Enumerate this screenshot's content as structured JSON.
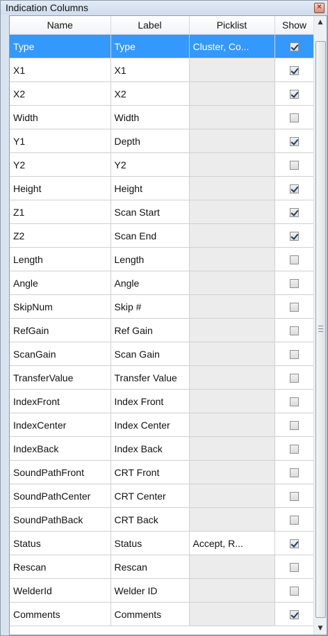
{
  "panel": {
    "title": "Indication Columns",
    "close_glyph": "✕"
  },
  "columns": {
    "name": "Name",
    "label": "Label",
    "picklist": "Picklist",
    "show": "Show"
  },
  "rows": [
    {
      "name": "Type",
      "label": "Type",
      "picklist": "Cluster, Co...",
      "show": true
    },
    {
      "name": "X1",
      "label": "X1",
      "picklist": "",
      "show": true
    },
    {
      "name": "X2",
      "label": "X2",
      "picklist": "",
      "show": true
    },
    {
      "name": "Width",
      "label": "Width",
      "picklist": "",
      "show": false
    },
    {
      "name": "Y1",
      "label": "Depth",
      "picklist": "",
      "show": true
    },
    {
      "name": "Y2",
      "label": "Y2",
      "picklist": "",
      "show": false
    },
    {
      "name": "Height",
      "label": "Height",
      "picklist": "",
      "show": true
    },
    {
      "name": "Z1",
      "label": "Scan Start",
      "picklist": "",
      "show": true
    },
    {
      "name": "Z2",
      "label": "Scan End",
      "picklist": "",
      "show": true
    },
    {
      "name": "Length",
      "label": "Length",
      "picklist": "",
      "show": false
    },
    {
      "name": "Angle",
      "label": "Angle",
      "picklist": "",
      "show": false
    },
    {
      "name": "SkipNum",
      "label": "Skip #",
      "picklist": "",
      "show": false
    },
    {
      "name": "RefGain",
      "label": "Ref Gain",
      "picklist": "",
      "show": false
    },
    {
      "name": "ScanGain",
      "label": "Scan Gain",
      "picklist": "",
      "show": false
    },
    {
      "name": "TransferValue",
      "label": "Transfer Value",
      "picklist": "",
      "show": false
    },
    {
      "name": "IndexFront",
      "label": "Index Front",
      "picklist": "",
      "show": false
    },
    {
      "name": "IndexCenter",
      "label": "Index Center",
      "picklist": "",
      "show": false
    },
    {
      "name": "IndexBack",
      "label": "Index Back",
      "picklist": "",
      "show": false
    },
    {
      "name": "SoundPathFront",
      "label": "CRT Front",
      "picklist": "",
      "show": false
    },
    {
      "name": "SoundPathCenter",
      "label": "CRT Center",
      "picklist": "",
      "show": false
    },
    {
      "name": "SoundPathBack",
      "label": "CRT Back",
      "picklist": "",
      "show": false
    },
    {
      "name": "Status",
      "label": "Status",
      "picklist": "Accept, R...",
      "show": true
    },
    {
      "name": "Rescan",
      "label": "Rescan",
      "picklist": "",
      "show": false
    },
    {
      "name": "WelderId",
      "label": "Welder ID",
      "picklist": "",
      "show": false
    },
    {
      "name": "Comments",
      "label": "Comments",
      "picklist": "",
      "show": true
    }
  ],
  "selected_row": 0,
  "scrollbar": {
    "up_glyph": "▲",
    "down_glyph": "▼"
  },
  "colors": {
    "selection": "#3399ff",
    "picklist_cell": "#ececec"
  }
}
